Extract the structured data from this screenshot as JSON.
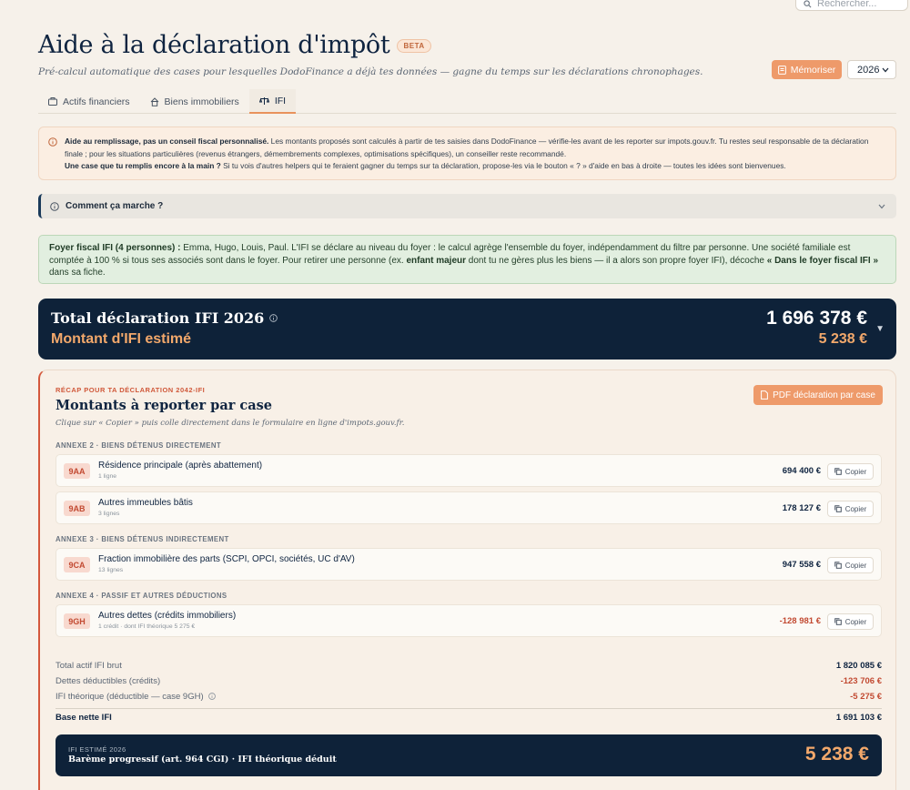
{
  "search": {
    "placeholder": "Rechercher..."
  },
  "header": {
    "title": "Aide à la déclaration d'impôt",
    "badge": "BETA",
    "subtitle": "Pré-calcul automatique des cases pour lesquelles DodoFinance a déjà tes données — gagne du temps sur les déclarations chronophages.",
    "memorize_label": "Mémoriser",
    "year": "2026"
  },
  "tabs": [
    {
      "label": "Actifs financiers",
      "icon": "briefcase-icon",
      "active": false
    },
    {
      "label": "Biens immobiliers",
      "icon": "house-icon",
      "active": false
    },
    {
      "label": "IFI",
      "icon": "scales-icon",
      "active": true
    }
  ],
  "notice": {
    "bold1": "Aide au remplissage, pas un conseil fiscal personnalisé.",
    "text1": " Les montants proposés sont calculés à partir de tes saisies dans DodoFinance — vérifie-les avant de les reporter sur impots.gouv.fr. Tu restes seul responsable de ta déclaration finale ; pour les situations particulières (revenus étrangers, démembrements complexes, optimisations spécifiques), un conseiller reste recommandé.",
    "bold2": "Une case que tu remplis encore à la main ?",
    "text2": " Si tu vois d'autres helpers qui te feraient gagner du temps sur ta déclaration, propose-les via le bouton « ? » d'aide en bas à droite — toutes les idées sont bienvenues."
  },
  "how": {
    "label": "Comment ça marche ?"
  },
  "foyer": {
    "bold1": "Foyer fiscal IFI (4 personnes) :",
    "text1": " Emma, Hugo, Louis, Paul. L'IFI se déclare au niveau du foyer : le calcul agrège l'ensemble du foyer, indépendamment du filtre par personne. Une société familiale est comptée à 100 % si tous ses associés sont dans le foyer. Pour retirer une personne (ex. ",
    "bold2": "enfant majeur",
    "text2": " dont tu ne gères plus les biens — il a alors son propre foyer IFI), décoche ",
    "bold3": "« Dans le foyer fiscal IFI »",
    "text3": " dans sa fiche."
  },
  "total": {
    "title": "Total déclaration IFI 2026",
    "subtitle": "Montant d'IFI estimé",
    "value": "1 696 378 €",
    "ifi": "5 238 €"
  },
  "recap": {
    "eyebrow": "RÉCAP POUR TA DÉCLARATION 2042-IFI",
    "title": "Montants à reporter par case",
    "hint": "Clique sur « Copier » puis colle directement dans le formulaire en ligne d'impots.gouv.fr.",
    "pdf_label": "PDF déclaration par case",
    "copy_label": "Copier",
    "sections": [
      {
        "title": "ANNEXE 2 · BIENS DÉTENUS DIRECTEMENT",
        "rows": [
          {
            "code": "9AA",
            "label": "Résidence principale (après abattement)",
            "sub": "1 ligne",
            "amount": "694 400 €"
          },
          {
            "code": "9AB",
            "label": "Autres immeubles bâtis",
            "sub": "3 lignes",
            "amount": "178 127 €"
          }
        ]
      },
      {
        "title": "ANNEXE 3 · BIENS DÉTENUS INDIRECTEMENT",
        "rows": [
          {
            "code": "9CA",
            "label": "Fraction immobilière des parts (SCPI, OPCI, sociétés, UC d'AV)",
            "sub": "13 lignes",
            "amount": "947 558 €"
          }
        ]
      },
      {
        "title": "ANNEXE 4 · PASSIF ET AUTRES DÉDUCTIONS",
        "rows": [
          {
            "code": "9GH",
            "label": "Autres dettes (crédits immobiliers)",
            "sub": "1 crédit · dont IFI théorique 5 275 €",
            "amount": "-128 981 €"
          }
        ]
      }
    ],
    "summary": [
      {
        "label": "Total actif IFI brut",
        "value": "1 820 085 €"
      },
      {
        "label": "Dettes déductibles (crédits)",
        "value": "-123 706 €"
      },
      {
        "label": "IFI théorique (déductible — case 9GH)",
        "value": "-5 275 €"
      },
      {
        "label": "Base nette IFI",
        "value": "1 691 103 €"
      }
    ],
    "ifi_box": {
      "eyebrow": "IFI ESTIMÉ 2026",
      "desc": "Barème progressif (art. 964 CGI) · IFI théorique déduit",
      "value": "5 238 €"
    }
  },
  "colors": {
    "accent": "#ee9a6a",
    "navy": "#0e2239",
    "negative": "#c24a32"
  }
}
